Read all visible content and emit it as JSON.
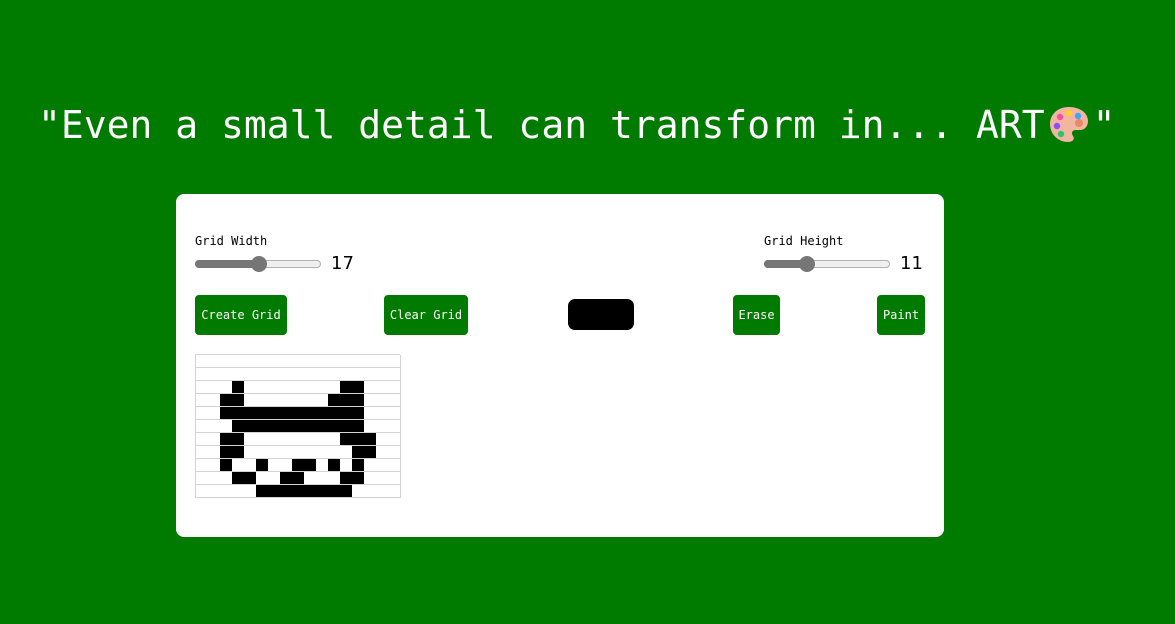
{
  "headline": {
    "text_before": "\"Even a small detail can transform in... ART",
    "text_after": "\"",
    "icon": "artist-palette-icon"
  },
  "controls": {
    "width_label": "Grid Width",
    "width_value": "17",
    "width_fraction": 0.5,
    "height_label": "Grid Height",
    "height_value": "11",
    "height_fraction": 0.33,
    "create_label": "Create Grid",
    "clear_label": "Clear Grid",
    "selected_color": "#000000",
    "erase_label": "Erase",
    "paint_label": "Paint"
  },
  "grid": {
    "columns": 17,
    "rows": 11,
    "painted": [
      "00000000000000000",
      "00000000000000000",
      "00010000000011000",
      "00110000000111000",
      "00111111111111000",
      "00011111111111000",
      "00110000000011100",
      "00110000000001100",
      "00100100110101000",
      "00011001100011000",
      "00000111111110000"
    ]
  },
  "colors": {
    "background": "#007b00",
    "panel": "#ffffff",
    "button": "#007b00",
    "paint": "#000000"
  }
}
